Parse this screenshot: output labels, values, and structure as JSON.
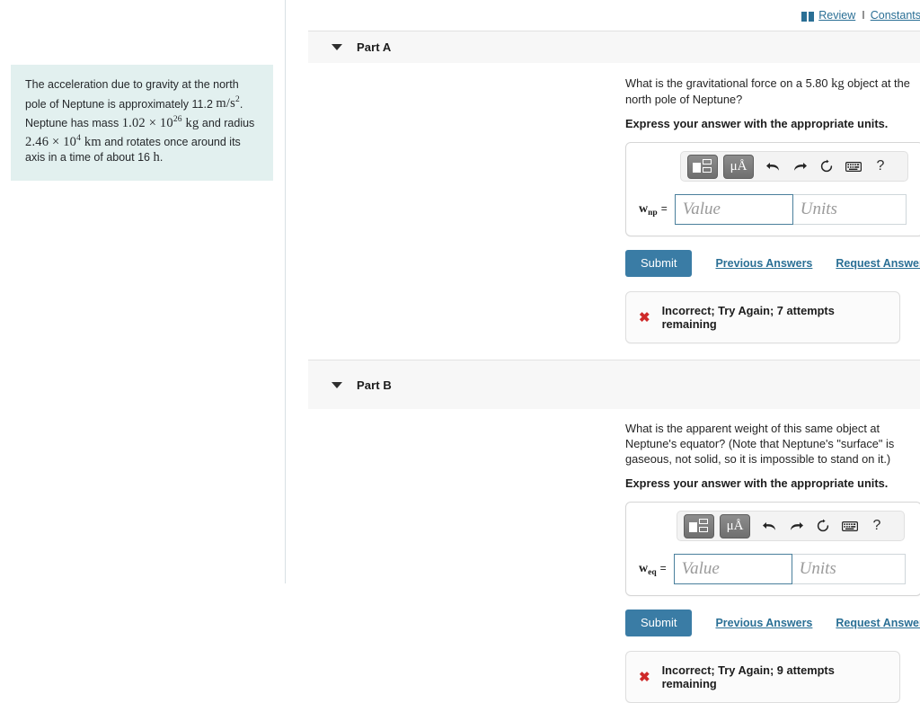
{
  "sidebar": {
    "info_text_1": "The acceleration due to gravity at the north pole of Neptune is approximately 11.2 ",
    "info_unit_1": "m/s",
    "info_unit_1_exp": "2",
    "info_text_2": ". Neptune has mass ",
    "info_val_2": "1.02 × 10",
    "info_val_2_exp": "26",
    "info_unit_2": " kg",
    "info_text_3": " and radius ",
    "info_val_3": "2.46 × 10",
    "info_val_3_exp": "4",
    "info_unit_3": " km",
    "info_text_4": " and rotates once around its axis in a time of about 16 ",
    "info_unit_4": "h",
    "info_text_5": "."
  },
  "toplinks": {
    "review_label": "Review",
    "separator": "I",
    "constants_label": "Constants"
  },
  "colors": {
    "accent_link": "#2a6f95",
    "submit_bg": "#3a7ca5",
    "error_red": "#cf2a2a",
    "info_bg": "#e2f0ef",
    "band_bg": "#f7f7f7",
    "field_focus_border": "#4a7f9c"
  },
  "toolbar": {
    "template_icon": "template-icon",
    "units_label": "μÅ",
    "undo_icon": "undo-icon",
    "redo_icon": "redo-icon",
    "reset_icon": "reset-icon",
    "keyboard_icon": "keyboard-icon",
    "help_label": "?"
  },
  "parts": [
    {
      "id": "A",
      "title": "Part A",
      "question_pre": "What is the gravitational force on a 5.80 ",
      "question_unit": "kg",
      "question_post": " object at the north pole of Neptune?",
      "instruction": "Express your answer with the appropriate units.",
      "var_base": "w",
      "var_sub": "np",
      "equals": "=",
      "value_placeholder": "Value",
      "units_placeholder": "Units",
      "value_current": "",
      "units_current": "",
      "submit_label": "Submit",
      "previous_answers_label": "Previous Answers",
      "request_answer_label": "Request Answer",
      "feedback": "Incorrect; Try Again; 7 attempts remaining"
    },
    {
      "id": "B",
      "title": "Part B",
      "question_pre": "What is the apparent weight of this same object at Neptune's equator? (Note that Neptune's \"surface\" is gaseous, not solid, so it is impossible to stand on it.)",
      "question_unit": "",
      "question_post": "",
      "instruction": "Express your answer with the appropriate units.",
      "var_base": "w",
      "var_sub": "eq",
      "equals": "=",
      "value_placeholder": "Value",
      "units_placeholder": "Units",
      "value_current": "",
      "units_current": "",
      "submit_label": "Submit",
      "previous_answers_label": "Previous Answers",
      "request_answer_label": "Request Answer",
      "feedback": "Incorrect; Try Again; 9 attempts remaining"
    }
  ]
}
